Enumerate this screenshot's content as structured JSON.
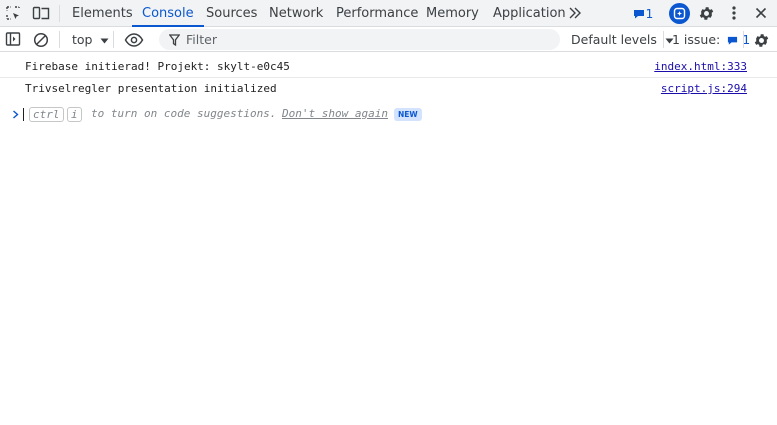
{
  "tabs": [
    {
      "label": "Elements"
    },
    {
      "label": "Console"
    },
    {
      "label": "Sources"
    },
    {
      "label": "Network"
    },
    {
      "label": "Performance"
    },
    {
      "label": "Memory"
    },
    {
      "label": "Application"
    }
  ],
  "topbar": {
    "messages_count": "1"
  },
  "toolbar": {
    "context": "top",
    "filter_placeholder": "Filter",
    "levels": "Default levels",
    "issues_label": "1 issue:",
    "issues_count": "1"
  },
  "console": {
    "messages": [
      {
        "text": "Firebase initierad! Projekt: skylt-e0c45",
        "source": "index.html:333"
      },
      {
        "text": "Trivselregler presentation initialized",
        "source": "script.js:294"
      }
    ],
    "prompt": {
      "key1": "ctrl",
      "key2": "i",
      "hint": "to turn on code suggestions.",
      "dismiss": "Don't show again",
      "badge": "NEW"
    }
  },
  "colors": {
    "accent": "#0b57d0",
    "link": "#1a0dab",
    "toolbar_bg": "#f1f3f4"
  }
}
